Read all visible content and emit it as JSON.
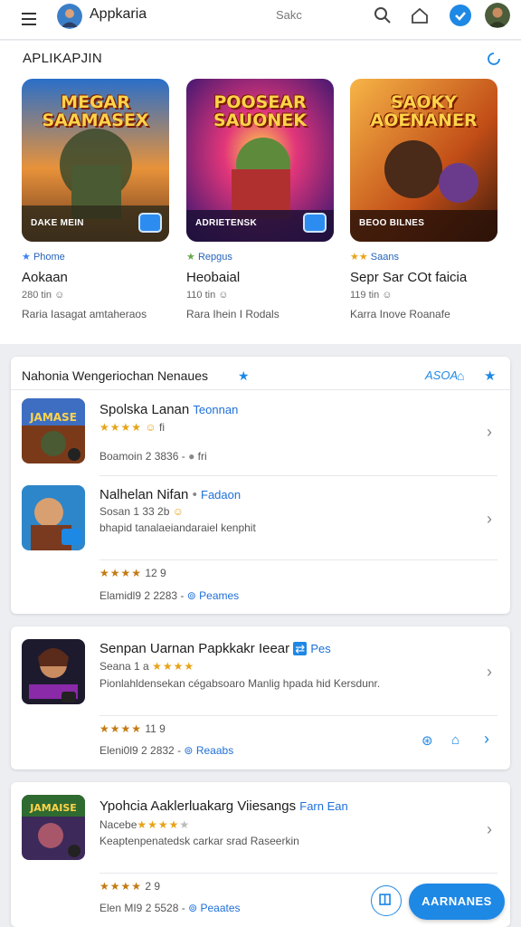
{
  "header": {
    "app_title": "Appkaria",
    "search_text": "Sakc"
  },
  "featured": {
    "title": "APLIKAPJIN",
    "cards": [
      {
        "thumb_title": "MEGAR SAAMASEX",
        "thumb_caption": "DAKE MEIN",
        "tag": "Phome",
        "name": "Aokaan",
        "sub": "280 tin",
        "desc": "Raria Iasagat amtaheraos",
        "colors": [
          "#f4a23a",
          "#b0461a"
        ]
      },
      {
        "thumb_title": "POOSEAR SAUONEK",
        "thumb_caption": "ADRIETENSK",
        "tag": "Repgus",
        "name": "Heobaial",
        "sub": "110 tin",
        "desc": "Rara Ihein I Rodals",
        "colors": [
          "#7a2bd1",
          "#e2367a"
        ]
      },
      {
        "thumb_title": "SAOKY AOENANER",
        "thumb_caption": "BEOO BILNES",
        "tag": "Saans",
        "name": "Sepr Sar COt faicia",
        "sub": "119 tin",
        "desc": "Karra Inove Roanafe",
        "colors": [
          "#f29a2e",
          "#b23c12"
        ]
      }
    ]
  },
  "section": {
    "title": "Nahonia Wengeriochan Nenaues",
    "link": "ASOA"
  },
  "rows": [
    {
      "title": "Spolska Lanan",
      "tag": "Teonnan",
      "rating": "★★★★",
      "rating_text": "fi",
      "meta": "Boamoin  2 3836 -",
      "meta_tail": "fri"
    },
    {
      "title": "Nalhelan Nifan",
      "tag": "Fadaon",
      "rating": "Sosan 1 33 2b",
      "desc": "bhapid tanalaeiandaraiel kenphit",
      "stars": "★★★★",
      "stars_val": "12 9",
      "meta": "Elamidl9  2 2283 -",
      "link": "Peames"
    },
    {
      "title": "Senpan Uarnan Papkkakr Ieear",
      "tag": "Pes",
      "rating": "Seana 1 a",
      "desc": "Pionlahldensekan cégabsoaro Manlig hpada hid Kersdunr.",
      "stars": "★★★★",
      "stars_val": "11 9",
      "meta": "Eleni0l9  2 2832 -",
      "link": "Reaabs"
    },
    {
      "title": "Ypohcia Aaklerluakarg Viiesangs",
      "tag": "Farn Ean",
      "rating": "Nacebe",
      "desc": "Keaptenpenatedsk carkar srad Raseerkin",
      "stars": "★★★★",
      "stars_val": "2 9",
      "meta": "Elen MI9  2 5528 -",
      "link": "Peaates"
    }
  ],
  "fab_label": "AARNANES",
  "accent": "#1e88e5"
}
